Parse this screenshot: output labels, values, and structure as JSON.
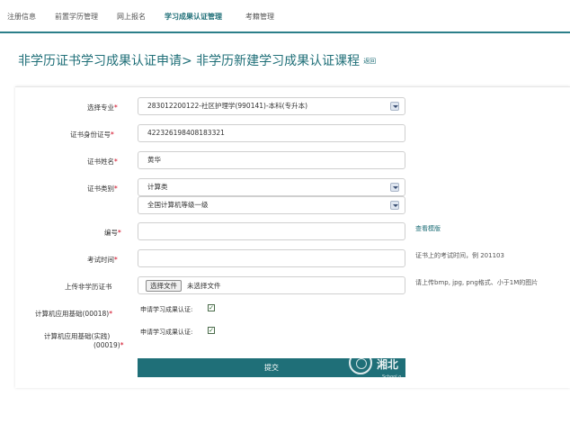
{
  "nav": {
    "items": [
      "注册信息",
      "前置学历管理",
      "网上报名",
      "学习成果认证管理",
      "考籍管理"
    ]
  },
  "page": {
    "title": "非学历证书学习成果认证申请> 非学历新建学习成果认证课程",
    "back_label": "返回"
  },
  "form": {
    "major_label": "选择专业",
    "major_value": "283012200122-社区护理学(990141)-本科(专升本)",
    "id_label": "证书身份证号",
    "id_value": "422326198408183321",
    "name_label": "证书姓名",
    "name_value": "黄华",
    "category_label": "证书类别",
    "category_value": "计算类",
    "subcategory_value": "全国计算机等级一级",
    "number_label": "编号",
    "number_value": "",
    "sample_link": "查看模版",
    "exam_time_label": "考试时间",
    "exam_time_value": "",
    "exam_time_hint": "证书上的考试时间，例 201103",
    "upload_label": "上传非学历证书",
    "file_button": "选择文件",
    "file_status": "未选择文件",
    "upload_hint": "请上传bmp, jpg, png格式、小于1M的图片",
    "course1_label": "计算机应用基础(00018)",
    "course1_check_text": "申请学习成果认证:",
    "course1_checked": "✓",
    "course2_label_line1": "计算机应用基础(实践)",
    "course2_label_line2": "(00019)",
    "course2_check_text": "申请学习成果认证:",
    "course2_checked": "✓",
    "required_mark": "*",
    "submit_label": "提交",
    "watermark_text": "湘北",
    "watermark_sub": "School o"
  }
}
